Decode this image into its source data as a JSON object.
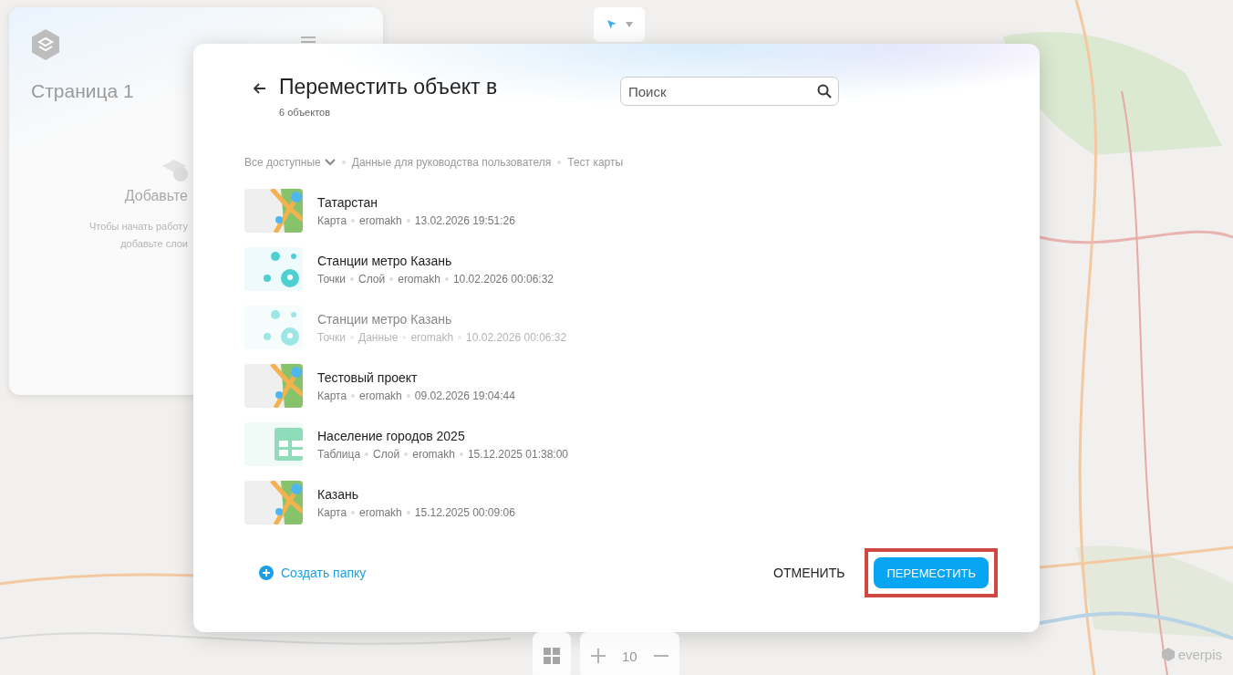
{
  "left_panel": {
    "title": "Страница 1",
    "empty_title": "Добавьте",
    "empty_lines": [
      "Чтобы начать работу",
      "добавьте слои"
    ]
  },
  "dialog": {
    "title": "Переместить объект в",
    "subtitle": "6 объектов",
    "search": {
      "placeholder": "Поиск"
    },
    "breadcrumbs": [
      {
        "label": "Все доступные",
        "dropdown": true
      },
      {
        "label": "Данные для руководства пользователя",
        "dropdown": false
      },
      {
        "label": "Тест карты",
        "dropdown": false
      }
    ],
    "items": [
      {
        "kind": "map",
        "title": "Татарстан",
        "meta": [
          "Карта",
          "eromakh",
          "13.02.2026 19:51:26"
        ],
        "disabled": false
      },
      {
        "kind": "points",
        "title": "Станции метро Казань",
        "meta": [
          "Точки",
          "Слой",
          "eromakh",
          "10.02.2026 00:06:32"
        ],
        "disabled": false
      },
      {
        "kind": "points",
        "title": "Станции метро Казань",
        "meta": [
          "Точки",
          "Данные",
          "eromakh",
          "10.02.2026 00:06:32"
        ],
        "disabled": true
      },
      {
        "kind": "map",
        "title": "Тестовый проект",
        "meta": [
          "Карта",
          "eromakh",
          "09.02.2026 19:04:44"
        ],
        "disabled": false
      },
      {
        "kind": "table",
        "title": "Население городов 2025",
        "meta": [
          "Таблица",
          "Слой",
          "eromakh",
          "15.12.2025 01:38:00"
        ],
        "disabled": false
      },
      {
        "kind": "map",
        "title": "Казань",
        "meta": [
          "Карта",
          "eromakh",
          "15.12.2025 00:09:06"
        ],
        "disabled": false
      }
    ],
    "create_folder": "Создать папку",
    "cancel": "ОТМЕНИТЬ",
    "submit": {
      "label": "ПЕРЕМЕСТИТЬ",
      "highlighted": true
    }
  },
  "zoom": {
    "level": "10"
  },
  "logo": "everpis"
}
